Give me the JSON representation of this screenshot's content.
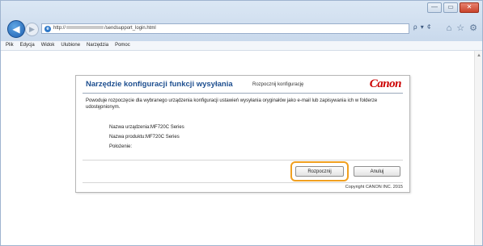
{
  "window": {
    "controls": [
      "—",
      "▭",
      "✕"
    ]
  },
  "browser": {
    "url_prefix": "http://",
    "url_suffix": "/sendsupport_login.html",
    "address_tools": "ρ ▾ ¢",
    "icons": [
      "home-icon",
      "star-icon",
      "gear-icon"
    ]
  },
  "menubar": {
    "items": [
      "Plik",
      "Edycja",
      "Widok",
      "Ulubione",
      "Narzędzia",
      "Pomoc"
    ]
  },
  "dialog": {
    "title": "Narzędzie konfiguracji funkcji wysyłania",
    "subtitle": "Rozpocznij konfigurację",
    "logo": "Canon",
    "description": "Powoduje rozpoczęcie dla wybranego urządzenia konfiguracji ustawień wysyłania oryginałów jako e-mail lub zapisywania ich w folderze udostępnionym.",
    "device_name": "Nazwa urządzenia:MF720C Series",
    "product_name": "Nazwa produktu:MF720C Series",
    "location": "Położenie:",
    "start_button": "Rozpocznij",
    "cancel_button": "Anuluj",
    "copyright": "Copyright CANON INC. 2015"
  },
  "colors": {
    "title_blue": "#1d4e8f",
    "canon_red": "#cc0000",
    "highlight_orange": "#f0a020"
  }
}
